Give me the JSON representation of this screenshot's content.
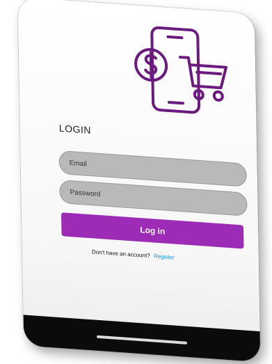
{
  "screen": {
    "title": "LOGIN"
  },
  "form": {
    "email_placeholder": "Email",
    "password_placeholder": "Password",
    "submit_label": "Log in"
  },
  "register": {
    "prompt": "Don't have an account?",
    "link_label": "Register"
  },
  "theme": {
    "accent": "#9c2bb5",
    "field_bg": "#b9b9b9",
    "link": "#1e8ae0",
    "icon_stroke": "#6a1b7d"
  },
  "icons": {
    "logo": "phone-payment-cart-icon"
  }
}
